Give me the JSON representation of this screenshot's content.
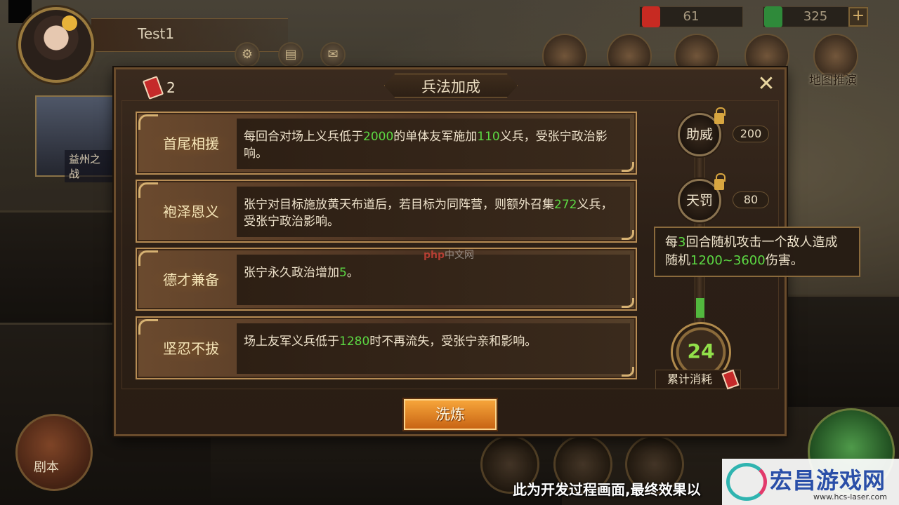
{
  "hud": {
    "player_name": "Test1",
    "currency_red": "61",
    "currency_green": "325",
    "plus_label": "+",
    "map_label": "地图推演",
    "side_card_label": "益州之战",
    "script_button_label": "剧本"
  },
  "dialog": {
    "title": "兵法加成",
    "token_count": "2",
    "close_label": "✕",
    "skills": [
      {
        "name": "首尾相援",
        "desc_parts": [
          "每回合对场上义兵低于",
          "2000",
          "的单体友军施加",
          "110",
          "义兵，受张宁政治影响。"
        ]
      },
      {
        "name": "袍泽恩义",
        "desc_parts": [
          "张宁对目标施放黄天布道后，若目标为同阵营，则额外召集",
          "272",
          "义兵，受张宁政治影响。"
        ]
      },
      {
        "name": "德才兼备",
        "desc_parts": [
          "张宁永久政治增加",
          "5",
          "。"
        ]
      },
      {
        "name": "坚忍不拔",
        "desc_parts": [
          "场上友军义兵低于",
          "1280",
          "时不再流失，受张宁亲和影响。"
        ]
      }
    ],
    "nodes": [
      {
        "name": "助威",
        "cost": "200"
      },
      {
        "name": "天罚",
        "cost": "80"
      }
    ],
    "tooltip_parts": [
      "每",
      "3",
      "回合随机攻击一个敌人造成随机",
      "1200~3600",
      "伤害。"
    ],
    "counter_value": "24",
    "total_label": "累计消耗",
    "refine_label": "洗炼"
  },
  "overlay": {
    "dev_notice": "此为开发过程画面,最终效果以",
    "watermark_title": "宏昌游戏网",
    "watermark_url": "www.hcs-laser.com",
    "php_mark": "php",
    "php_text": "中文网"
  },
  "colors": {
    "highlight": "#5cd943",
    "button_orange": "#e8862a",
    "frame_gold": "#b68c54"
  }
}
